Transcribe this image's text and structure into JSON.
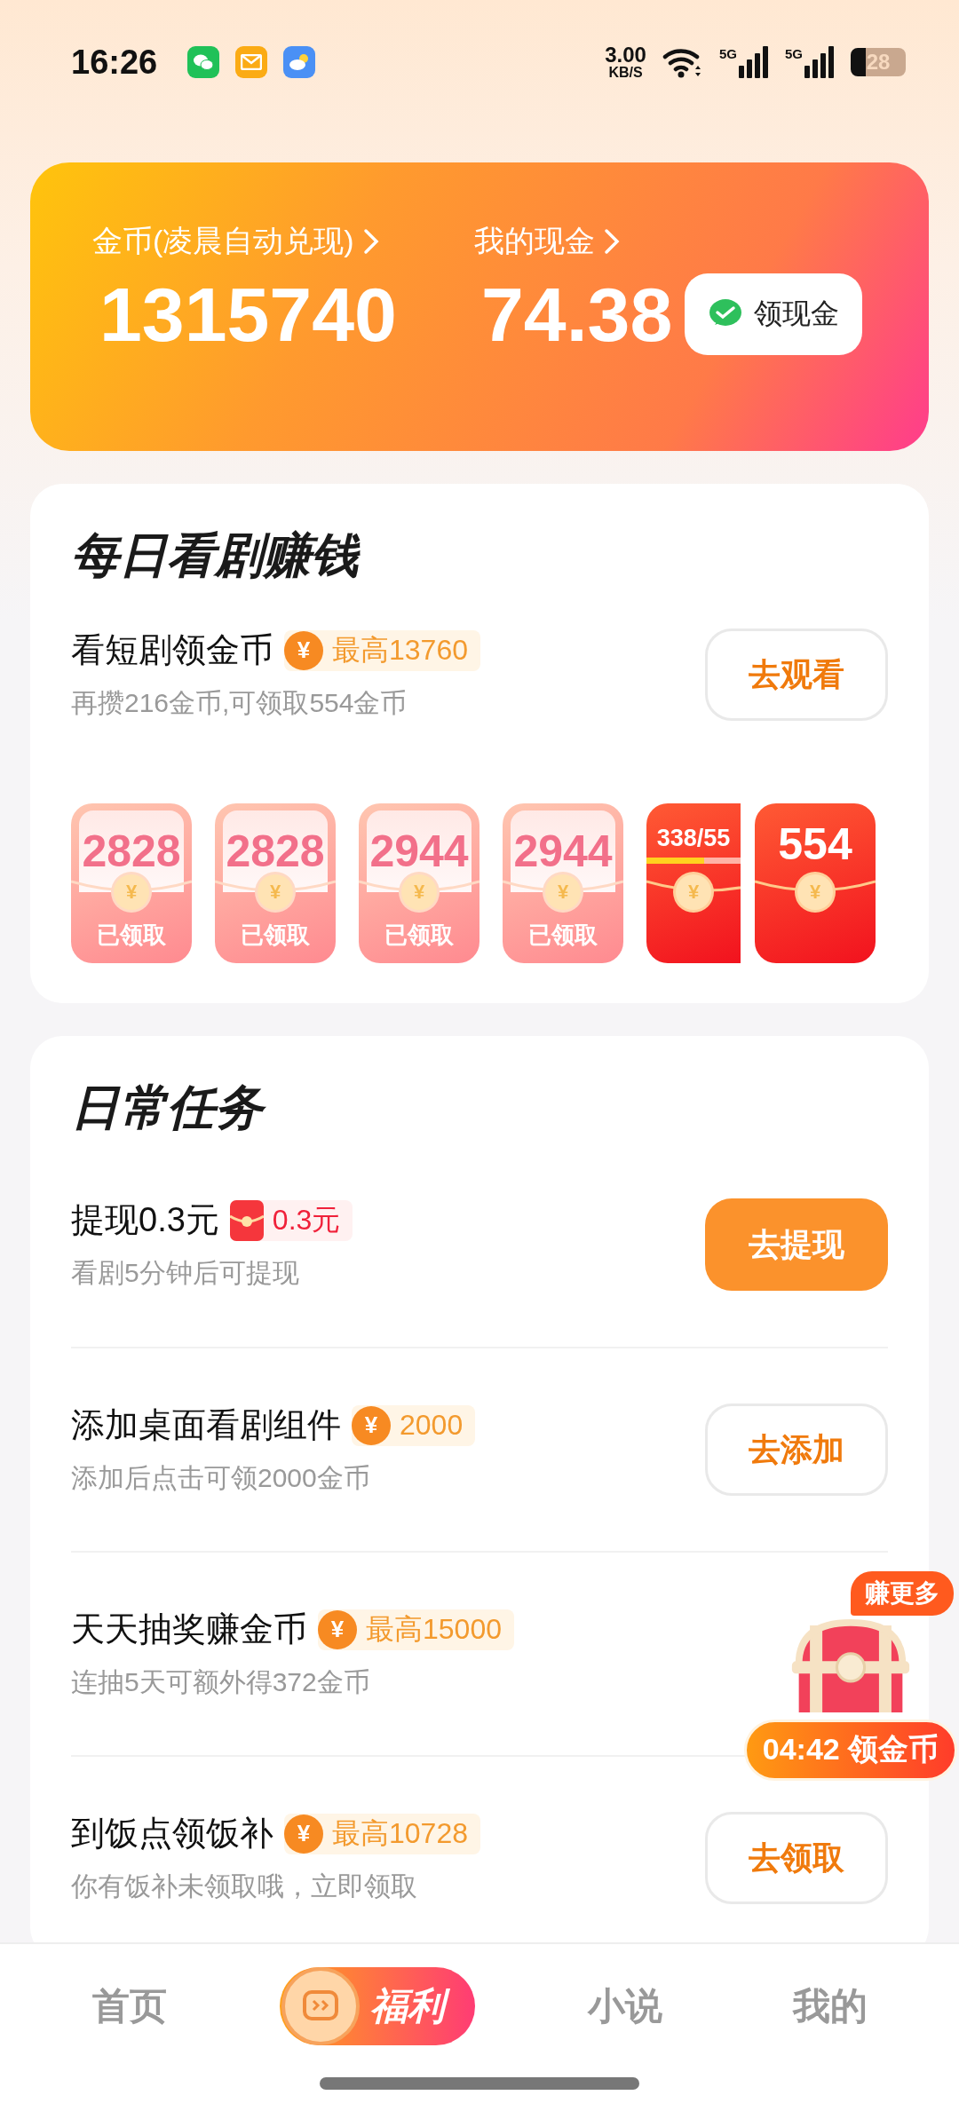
{
  "status_bar": {
    "time": "16:26",
    "net_speed": "3.00",
    "net_unit": "KB/S",
    "sim_1": "5G",
    "sim_2": "5G",
    "battery": "28"
  },
  "wallet": {
    "coins_label": "金币(凌晨自动兑现)",
    "coins": "1315740",
    "cash_label": "我的现金",
    "cash": "74.38",
    "cash_button": "领现金"
  },
  "drama_section": {
    "title": "每日看剧赚钱",
    "task": {
      "title": "看短剧领金币",
      "badge": {
        "kind": "coin",
        "icon_text": "¥",
        "text": "最高13760"
      },
      "subtitle": "再攒216金币,可领取554金币",
      "button": {
        "label": "去观看",
        "kind": "outline"
      }
    },
    "packets": [
      {
        "kind": "claimed",
        "amount": "2828",
        "icon_text": "¥",
        "status": "已领取"
      },
      {
        "kind": "claimed",
        "amount": "2828",
        "icon_text": "¥",
        "status": "已领取"
      },
      {
        "kind": "claimed",
        "amount": "2944",
        "icon_text": "¥",
        "status": "已领取"
      },
      {
        "kind": "claimed",
        "amount": "2944",
        "icon_text": "¥",
        "status": "已领取"
      },
      {
        "kind": "progress",
        "amount": "338/55",
        "icon_text": "¥",
        "level": 0.61
      },
      {
        "kind": "reward",
        "amount": "554",
        "icon_text": "¥"
      }
    ]
  },
  "daily_tasks": {
    "title": "日常任务",
    "tasks": [
      {
        "title": "提现0.3元",
        "badge": {
          "kind": "red_packet",
          "text": "0.3元"
        },
        "subtitle": "看剧5分钟后可提现",
        "button": {
          "label": "去提现",
          "kind": "filled"
        }
      },
      {
        "title": "添加桌面看剧组件",
        "badge": {
          "kind": "coin",
          "icon_text": "¥",
          "text": "2000"
        },
        "subtitle": "添加后点击可领2000金币",
        "button": {
          "label": "去添加",
          "kind": "outline"
        }
      },
      {
        "title": "天天抽奖赚金币",
        "badge": {
          "kind": "coin",
          "icon_text": "¥",
          "text": "最高15000"
        },
        "subtitle": "连抽5天可额外得372金币"
      },
      {
        "title": "到饭点领饭补",
        "badge": {
          "kind": "coin",
          "icon_text": "¥",
          "text": "最高10728"
        },
        "subtitle": "你有饭补未领取哦，立即领取",
        "button": {
          "label": "去领取",
          "kind": "outline"
        }
      }
    ]
  },
  "floating_reward": {
    "badge": "赚更多",
    "timer": "04:42 领金币"
  },
  "nav": [
    {
      "label": "首页",
      "selected": false
    },
    {
      "label": "福利",
      "selected": true
    },
    {
      "label": "小说",
      "selected": false
    },
    {
      "label": "我的",
      "selected": false
    }
  ]
}
